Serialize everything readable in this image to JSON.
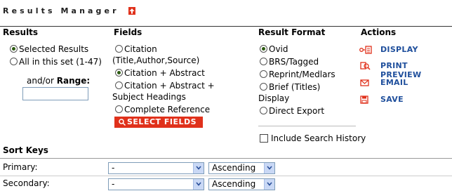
{
  "title": "Results Manager",
  "headers": {
    "results": "Results",
    "fields": "Fields",
    "format": "Result Format",
    "actions": "Actions"
  },
  "results": {
    "selected": "Selected Results",
    "all": "All in this set (1-47)",
    "range_prefix": "and/or",
    "range_label": "Range:",
    "range_value": "",
    "selected_option": "Selected Results"
  },
  "fields": {
    "citation_l1": "Citation",
    "citation_l2": "(Title,Author,Source)",
    "cit_abstract": "Citation + Abstract",
    "cit_abs_subj_l1": "Citation + Abstract +",
    "cit_abs_subj_l2": "Subject Headings",
    "complete": "Complete Reference",
    "select_btn": "SELECT FIELDS",
    "selected_option": "Citation + Abstract"
  },
  "format": {
    "ovid": "Ovid",
    "brs": "BRS/Tagged",
    "reprint": "Reprint/Medlars",
    "brief_l1": "Brief (Titles)",
    "brief_l2": "Display",
    "direct": "Direct Export",
    "history": "Include Search History",
    "history_checked": false,
    "selected_option": "Ovid"
  },
  "actions": {
    "display": "DISPLAY",
    "print": "PRINT PREVIEW",
    "email": "EMAIL",
    "save": "SAVE"
  },
  "sort": {
    "title": "Sort Keys",
    "rows": [
      {
        "label": "Primary:",
        "key": "-",
        "order": "Ascending"
      },
      {
        "label": "Secondary:",
        "key": "-",
        "order": "Ascending"
      }
    ]
  },
  "colors": {
    "accent_red": "#e0311b",
    "link_blue": "#1f4f9c",
    "radio_green": "#2d5b12"
  }
}
